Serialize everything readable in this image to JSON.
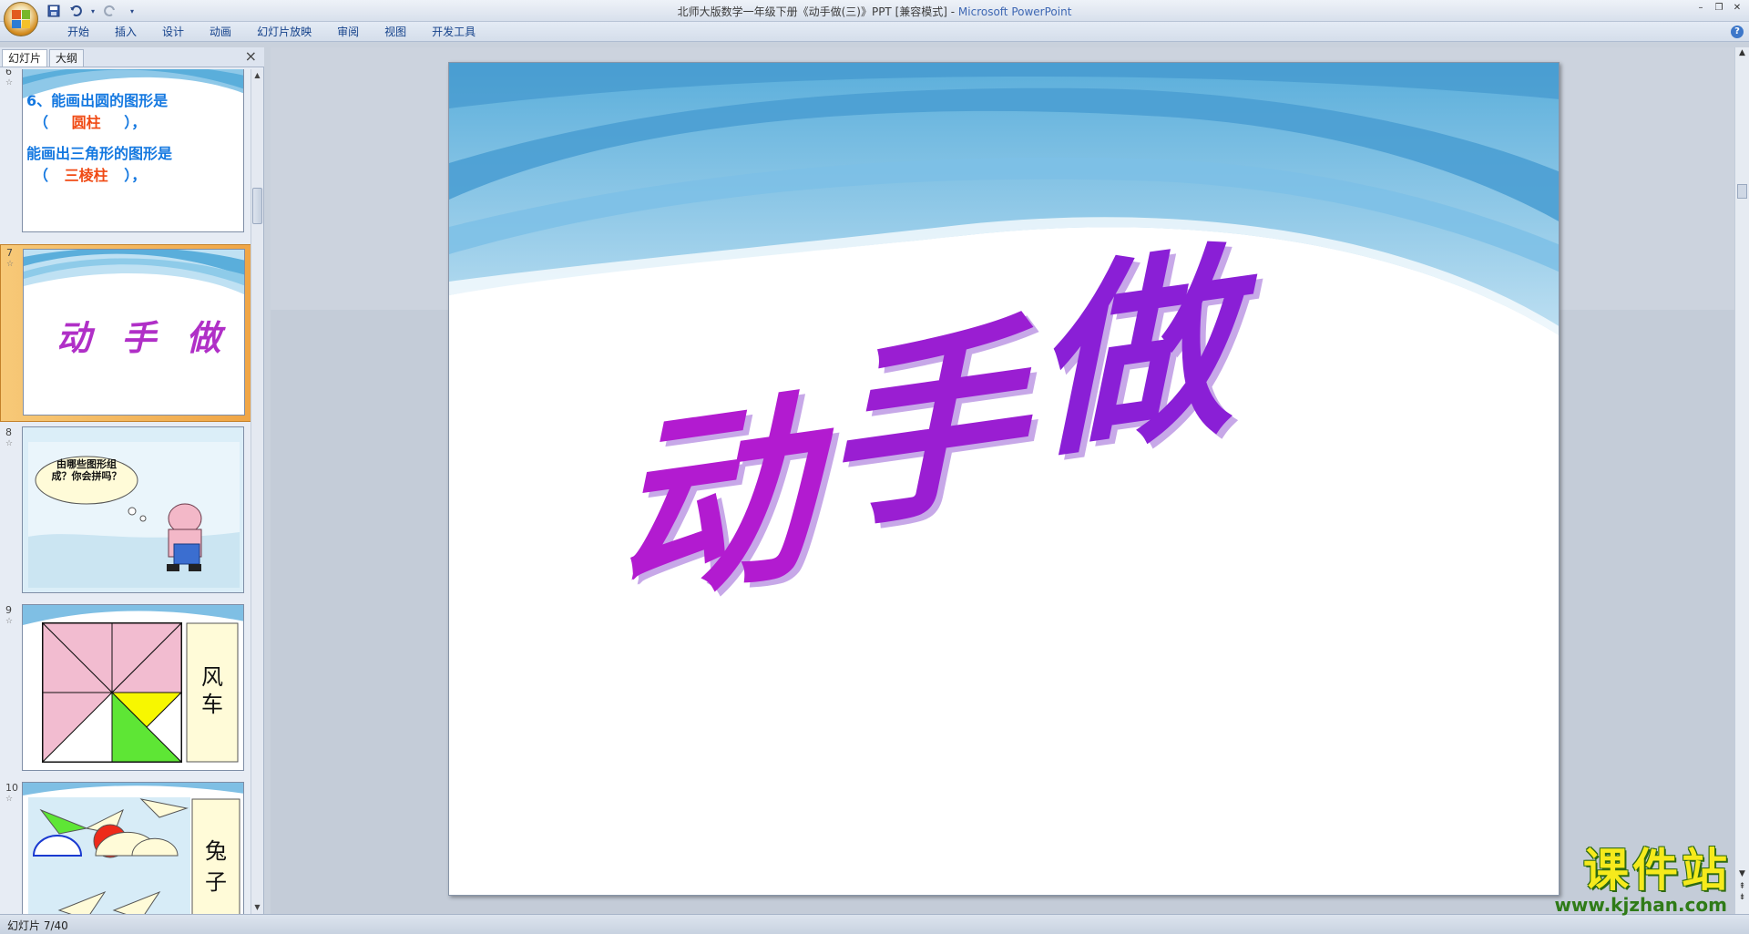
{
  "window": {
    "title": "北师大版数学一年级下册《动手做(三)》PPT [兼容模式] - ",
    "app_name": "Microsoft PowerPoint"
  },
  "qat": {
    "save_icon": "save-icon",
    "undo_icon": "undo-icon",
    "redo_icon": "redo-icon"
  },
  "ribbon": {
    "tabs": [
      "开始",
      "插入",
      "设计",
      "动画",
      "幻灯片放映",
      "审阅",
      "视图",
      "开发工具"
    ]
  },
  "left_panel": {
    "tab_slides": "幻灯片",
    "tab_outline": "大纲",
    "close": "×",
    "slides": [
      {
        "num": "6",
        "line1a": "6、能画出圆的图形是",
        "line1b_open": "（",
        "line1b_answer": "圆柱",
        "line1b_close": "），",
        "line2a": "能画出三角形的图形是",
        "line2b_open": "（",
        "line2b_answer": "三棱柱",
        "line2b_close": "），"
      },
      {
        "num": "7",
        "title": "动 手 做"
      },
      {
        "num": "8",
        "bubble": "由哪些图形组成？你会拼吗？"
      },
      {
        "num": "9",
        "label": "风车"
      },
      {
        "num": "10",
        "label": "兔子"
      }
    ]
  },
  "slide": {
    "title_chars": [
      "动",
      "手",
      "做"
    ]
  },
  "status": {
    "text": "幻灯片 7/40"
  },
  "watermark": {
    "title": "课件站",
    "url": "www.kjzhan.com"
  },
  "colors": {
    "accent": "#3d67b3",
    "selected_thumb": "#f0a545",
    "title_purple": "#a020c8"
  }
}
